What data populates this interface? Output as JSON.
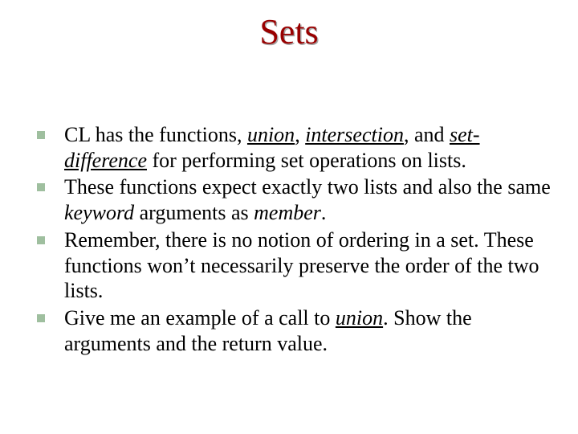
{
  "title": "Sets",
  "bullets": [
    {
      "pre": "CL has the functions, ",
      "w1": "union",
      "sep1": ", ",
      "w2": "intersection",
      "sep2": ", and ",
      "w3": "set-difference",
      "post": " for performing set operations on lists."
    },
    {
      "pre": "These functions expect exactly two lists and  also the same ",
      "w1": "keyword",
      "mid": " arguments as ",
      "w2": "member",
      "post": "."
    },
    {
      "text": "Remember, there is no notion of ordering in a set. These functions won’t necessarily preserve the order of the two lists."
    },
    {
      "pre": "Give me an example of a call to ",
      "w1": "union",
      "post": ".  Show  the arguments and the return value."
    }
  ]
}
